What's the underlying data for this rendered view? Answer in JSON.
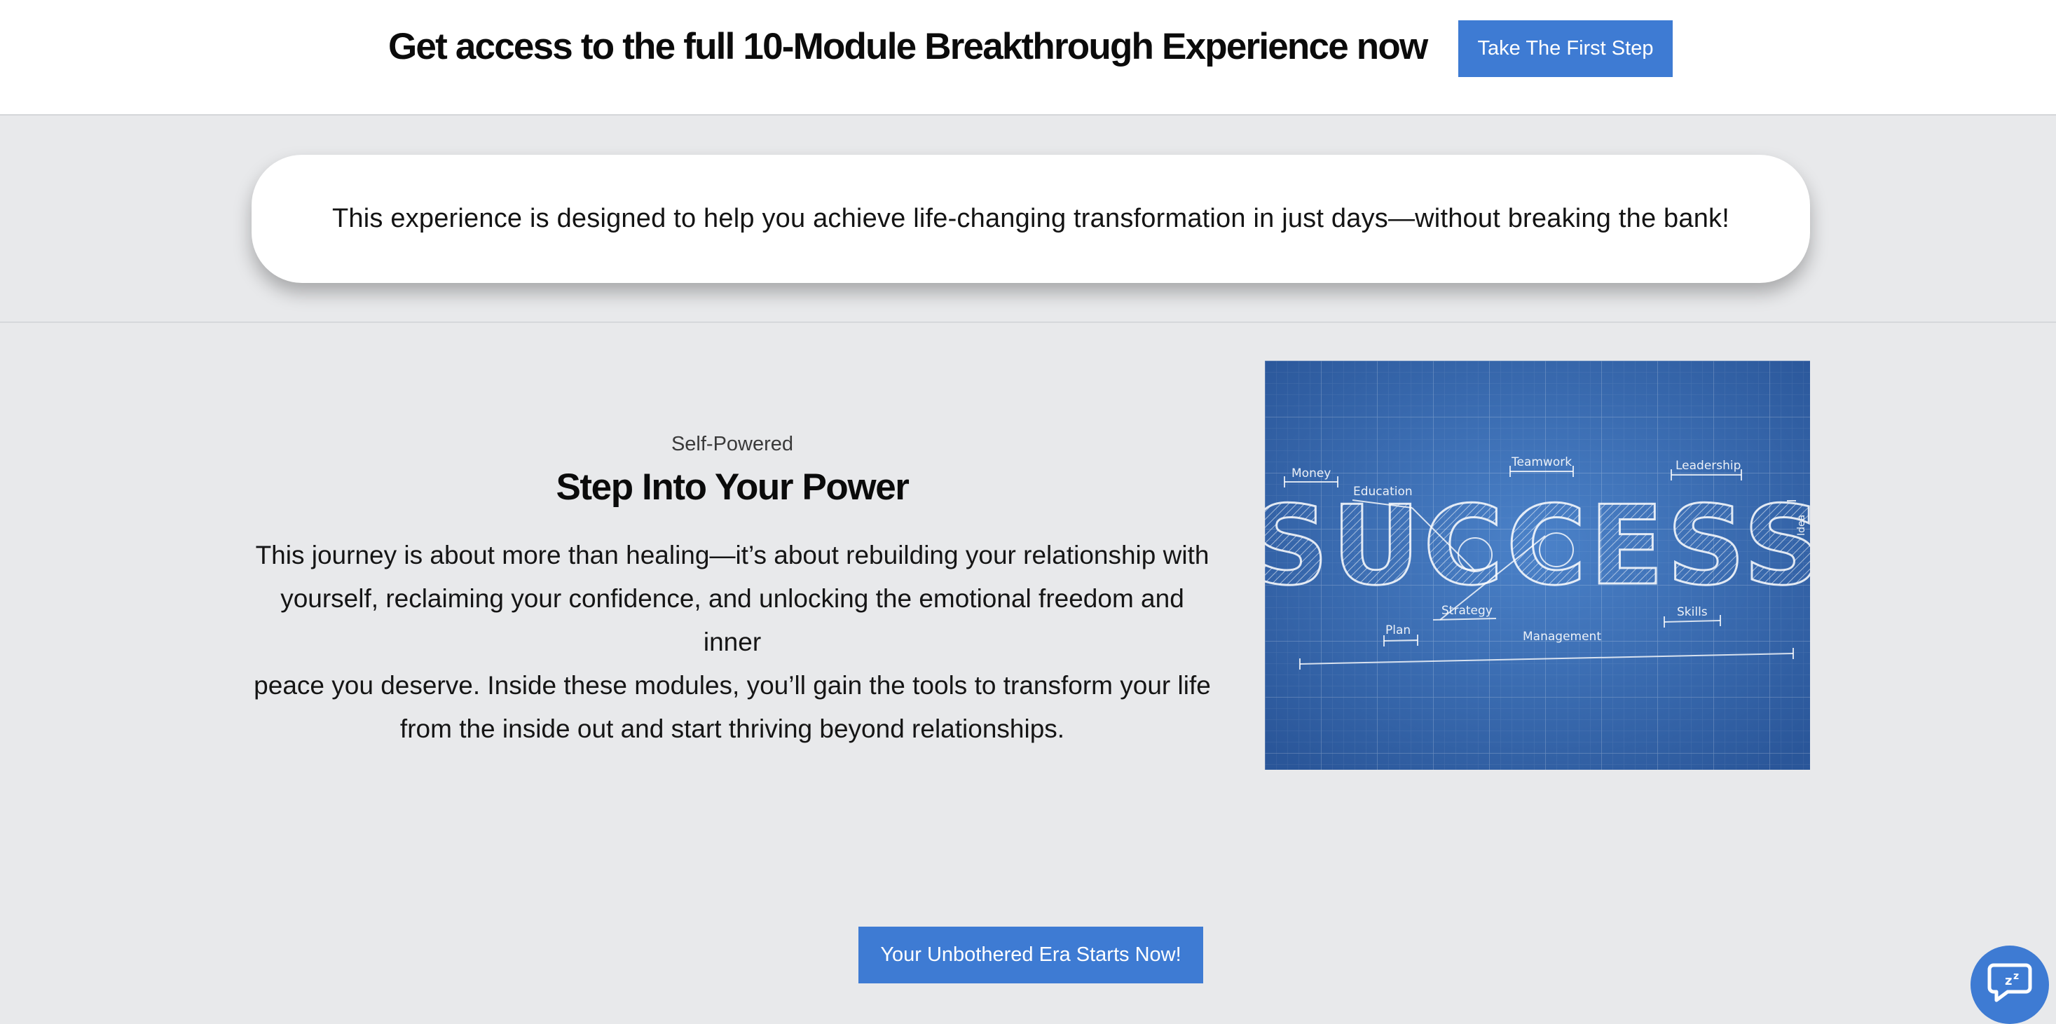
{
  "topbar": {
    "title": "Get access to the full 10-Module Breakthrough Experience now",
    "button_label": "Take The First Step"
  },
  "banner": {
    "text": "This experience is designed to help you achieve life-changing transformation in just days—without breaking the bank!"
  },
  "feature": {
    "eyebrow": "Self-Powered",
    "heading": "Step Into Your Power",
    "body_lines": [
      "This journey is about more than healing—it’s about rebuilding your relationship with",
      "yourself, reclaiming your confidence, and unlocking the emotional freedom and inner",
      "peace you deserve. Inside these modules, you’ll gain the tools to transform your life",
      "from the inside out and start thriving beyond relationships."
    ],
    "image": {
      "word": "SUCCESS",
      "labels": {
        "money": "Money",
        "education": "Education",
        "teamwork": "Teamwork",
        "leadership": "Leadership",
        "idea": "Idea",
        "plan": "Plan",
        "strategy": "Strategy",
        "management": "Management",
        "skills": "Skills"
      }
    }
  },
  "cta": {
    "label": "Your Unbothered Era Starts Now!"
  },
  "chat": {
    "icon": "chat-bubble-icon"
  },
  "colors": {
    "accent": "#3e7bd3",
    "page_bg": "#e8e9eb",
    "blueprint": "#3565ad"
  }
}
